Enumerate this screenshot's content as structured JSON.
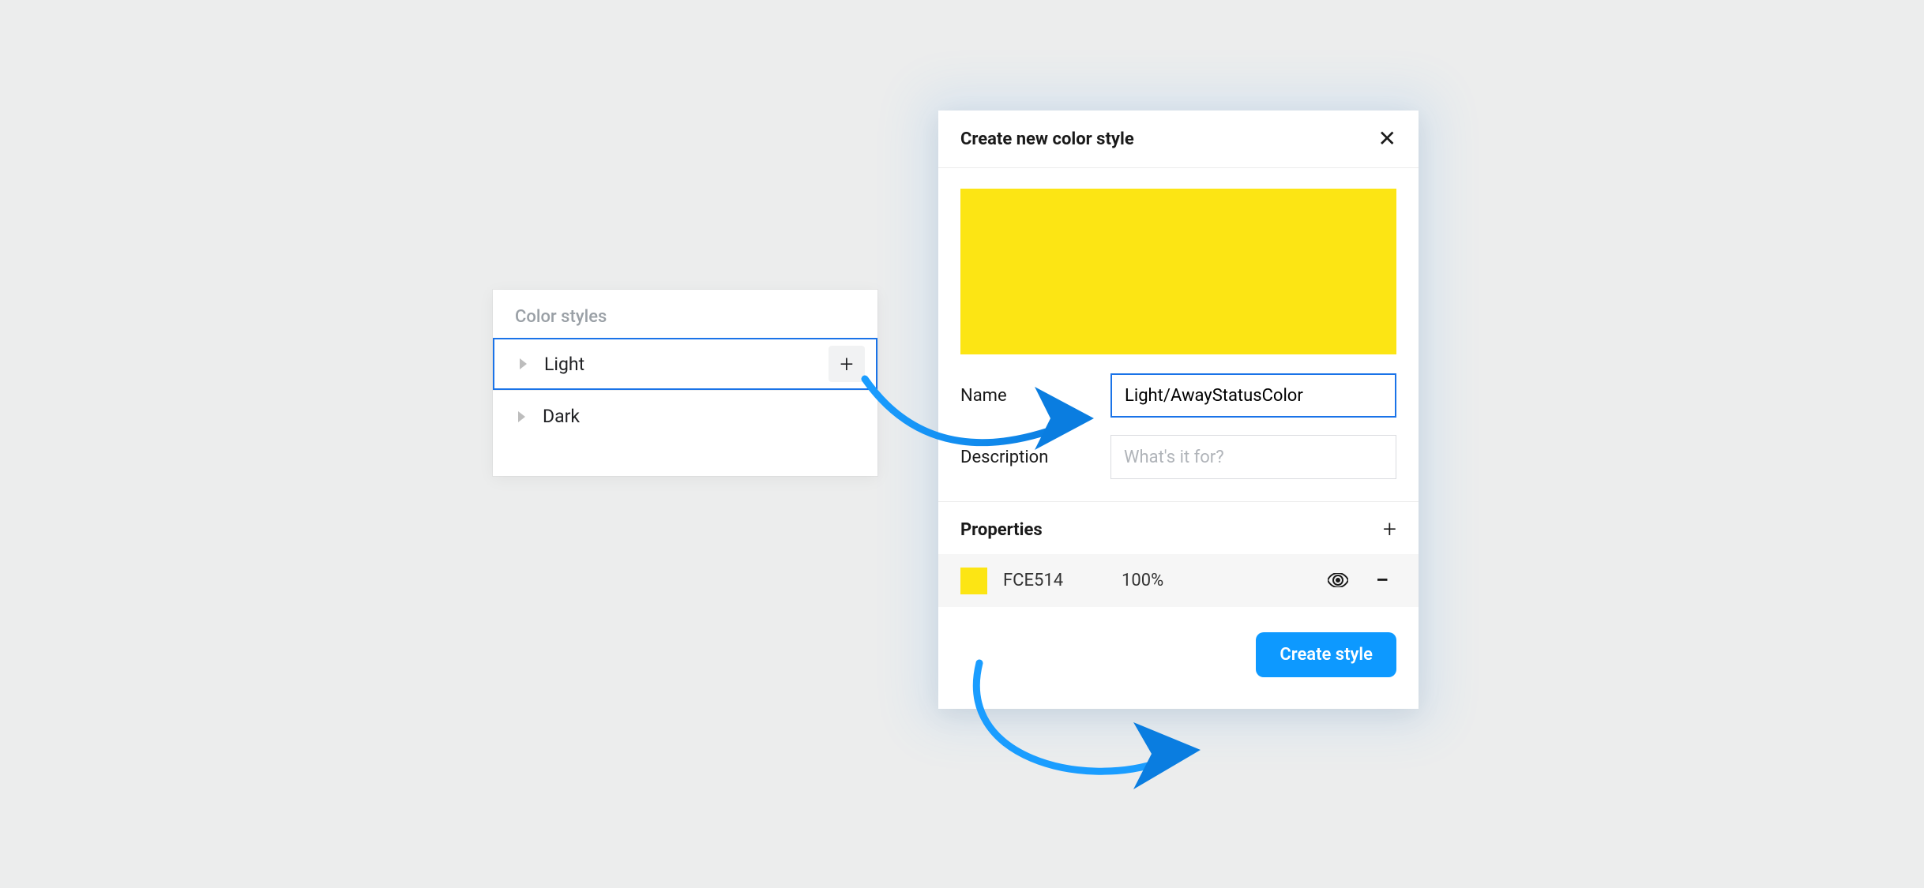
{
  "stylesPanel": {
    "header": "Color styles",
    "rows": [
      {
        "label": "Light",
        "selected": true,
        "showAdd": true
      },
      {
        "label": "Dark",
        "selected": false,
        "showAdd": false
      }
    ]
  },
  "dialog": {
    "title": "Create new color style",
    "previewColor": "#FCE514",
    "nameLabel": "Name",
    "nameValue": "Light/AwayStatusColor",
    "descLabel": "Description",
    "descPlaceholder": "What's it for?",
    "propsLabel": "Properties",
    "property": {
      "hex": "FCE514",
      "opacity": "100%"
    },
    "createButton": "Create style"
  }
}
